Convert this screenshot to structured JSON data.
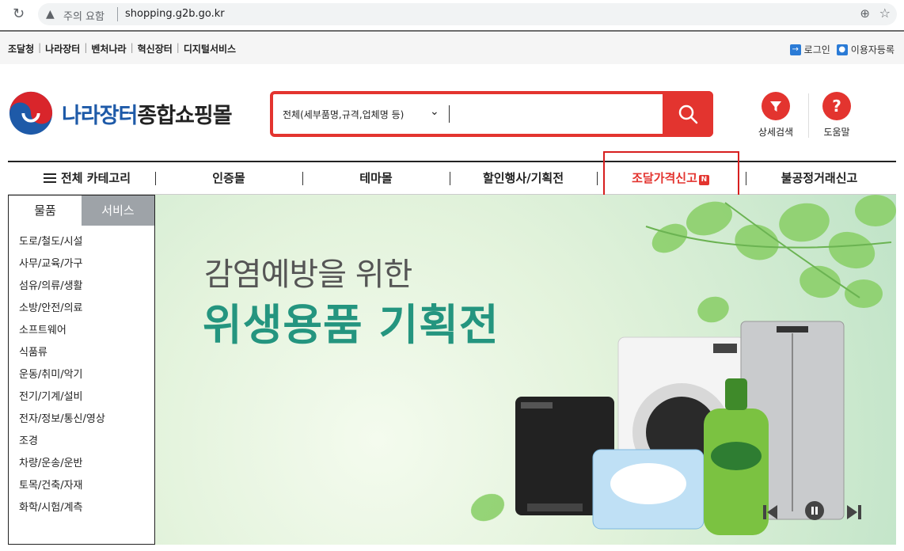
{
  "browser": {
    "warning": "주의 요함",
    "url": "shopping.g2b.go.kr"
  },
  "util": {
    "links": [
      "조달청",
      "나라장터",
      "벤처나라",
      "혁신장터",
      "디지털서비스"
    ],
    "login": "로그인",
    "register": "이용자등록"
  },
  "header": {
    "logo_blue": "나라장터",
    "logo_dark": "종합쇼핑몰",
    "search_category": "전체(세부품명,규격,업체명 등)",
    "search_value": "",
    "detail_search": "상세검색",
    "help": "도움말"
  },
  "gnb": {
    "all_category": "전체 카테고리",
    "items": [
      "인증몰",
      "테마몰",
      "할인행사/기획전",
      "조달가격신고",
      "불공정거래신고"
    ],
    "new_badge": "N"
  },
  "category": {
    "tabs": [
      "물품",
      "서비스"
    ],
    "items": [
      "도로/철도/시설",
      "사무/교육/가구",
      "섬유/의류/생활",
      "소방/안전/의료",
      "소프트웨어",
      "식품류",
      "운동/취미/악기",
      "전기/기계/설비",
      "전자/정보/통신/영상",
      "조경",
      "차량/운송/운반",
      "토목/건축/자재",
      "화학/시험/계측"
    ]
  },
  "banner": {
    "subtitle": "감염예방을 위한",
    "title": "위생용품 기획전"
  },
  "colors": {
    "accent": "#e3342f",
    "banner_title": "#24957f",
    "brand_blue": "#1e5aa8"
  }
}
